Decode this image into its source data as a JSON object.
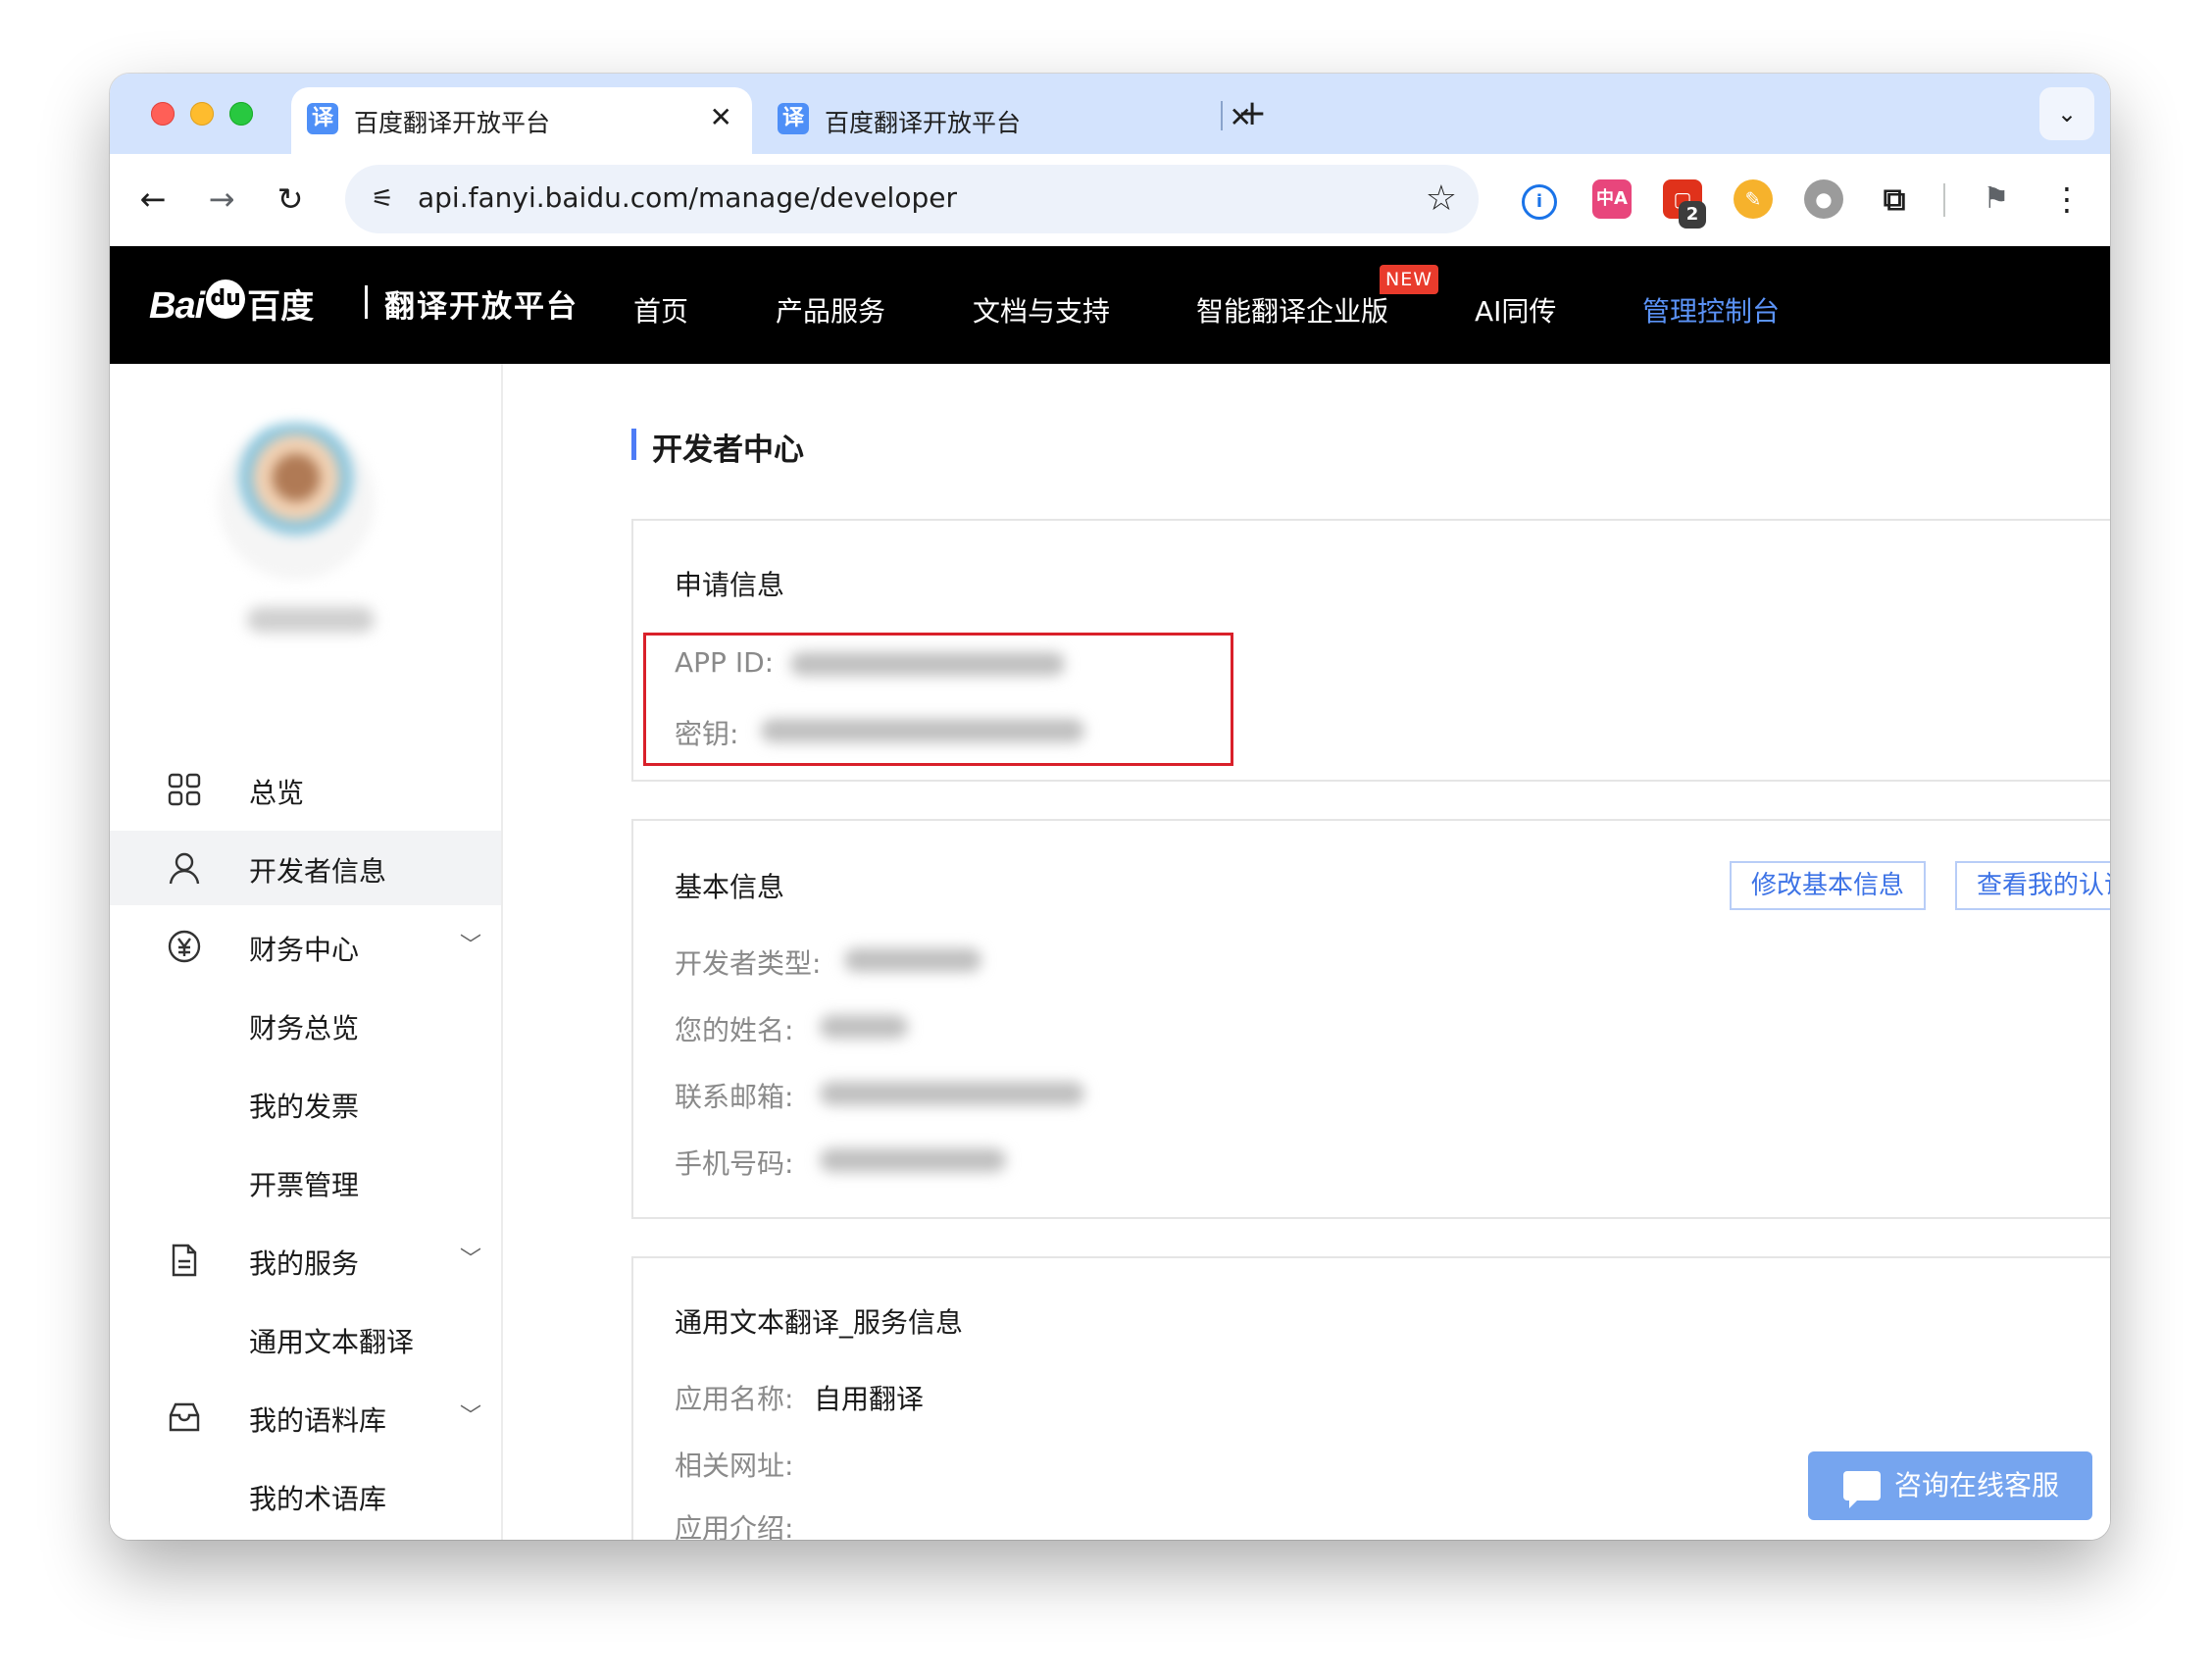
{
  "browser": {
    "tabs": [
      {
        "title": "百度翻译开放平台",
        "favicon": "译",
        "active": true
      },
      {
        "title": "百度翻译开放平台",
        "favicon": "译",
        "active": false
      }
    ],
    "new_tab_symbol": "+",
    "tab_menu_symbol": "⌄",
    "url": "api.fanyi.baidu.com/manage/developer",
    "extensions": [
      {
        "name": "password-manager-icon"
      },
      {
        "name": "translate-extension-icon",
        "text": "中A"
      },
      {
        "name": "red-extension-icon",
        "badge": "2"
      },
      {
        "name": "yellow-extension-icon"
      },
      {
        "name": "gray-extension-icon"
      },
      {
        "name": "extensions-puzzle-icon"
      },
      {
        "name": "flag-extension-icon"
      }
    ]
  },
  "header": {
    "logo_bai": "Bai",
    "logo_du": "du",
    "logo_cn": "百度",
    "platform_name": "翻译开放平台",
    "nav": [
      {
        "label": "首页"
      },
      {
        "label": "产品服务"
      },
      {
        "label": "文档与支持"
      },
      {
        "label": "智能翻译企业版",
        "badge": "NEW"
      },
      {
        "label": "AI同传"
      },
      {
        "label": "管理控制台",
        "active": true
      }
    ],
    "active_color": "#5b93f7"
  },
  "sidebar": {
    "items": [
      {
        "label": "总览",
        "icon": "grid-icon"
      },
      {
        "label": "开发者信息",
        "icon": "user-icon",
        "active": true
      },
      {
        "label": "财务中心",
        "icon": "yen-icon",
        "expandable": true
      },
      {
        "label": "财务总览"
      },
      {
        "label": "我的发票"
      },
      {
        "label": "开票管理"
      },
      {
        "label": "我的服务",
        "icon": "document-icon",
        "expandable": true
      },
      {
        "label": "通用文本翻译"
      },
      {
        "label": "我的语料库",
        "icon": "inbox-icon",
        "expandable": true
      },
      {
        "label": "我的术语库"
      }
    ]
  },
  "main": {
    "page_title": "开发者中心",
    "application_info": {
      "title": "申请信息",
      "app_id_label": "APP ID:",
      "secret_label": "密钥:"
    },
    "basic_info": {
      "title": "基本信息",
      "edit_button": "修改基本信息",
      "view_cert_button": "查看我的认证",
      "fields": [
        {
          "label": "开发者类型:"
        },
        {
          "label": "您的姓名:"
        },
        {
          "label": "联系邮箱:"
        },
        {
          "label": "手机号码:"
        }
      ]
    },
    "service_info": {
      "title": "通用文本翻译_服务信息",
      "app_name_label": "应用名称:",
      "app_name_value": "自用翻译",
      "related_url_label": "相关网址:",
      "app_intro_label": "应用介绍:"
    },
    "chat_button": "咨询在线客服"
  },
  "colors": {
    "accent": "#4e7cf6",
    "highlight_border": "#d9202a",
    "chat_button": "#76a5ef"
  }
}
